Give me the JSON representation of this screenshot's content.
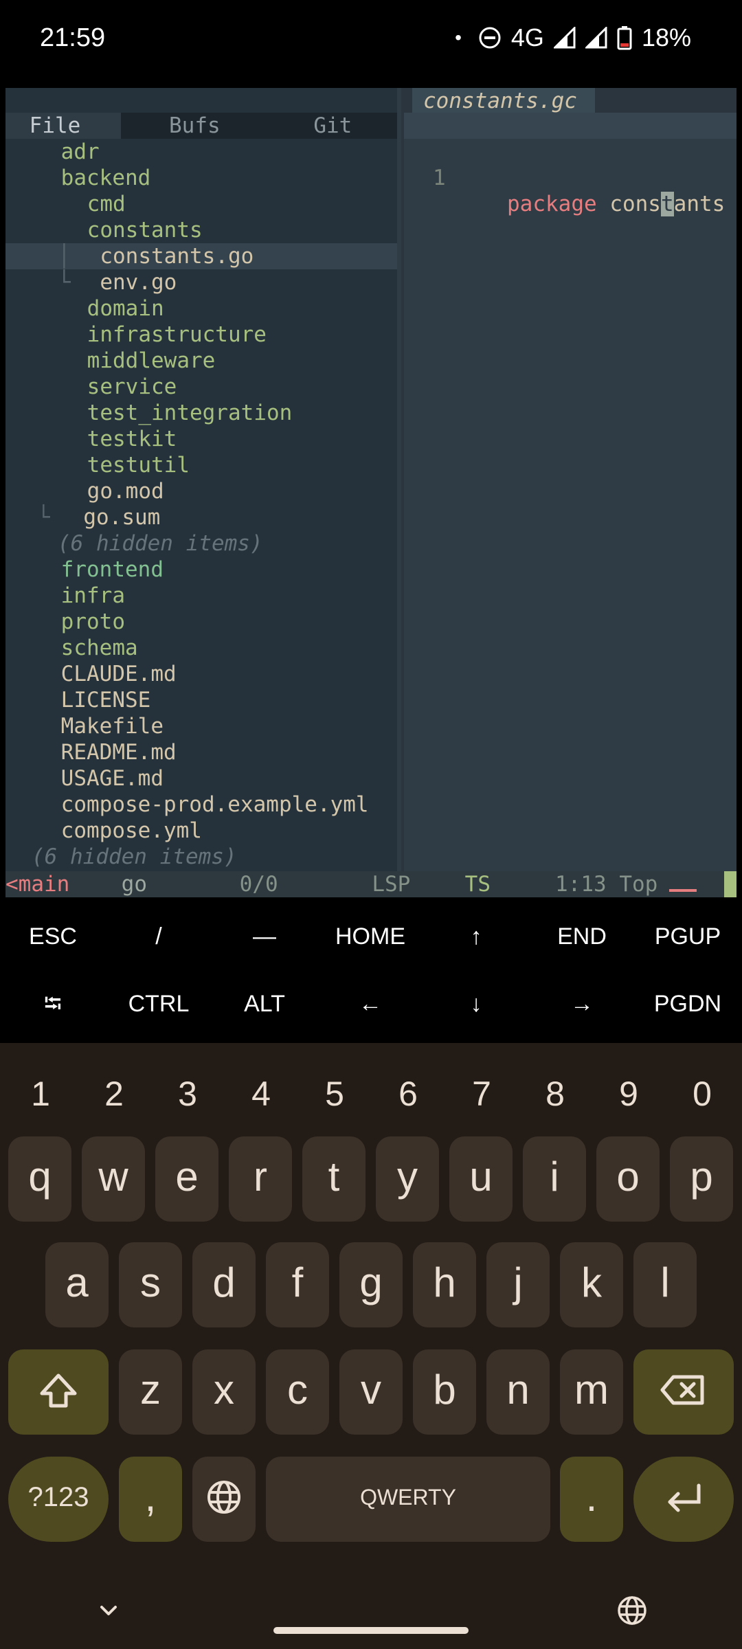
{
  "status_bar": {
    "time": "21:59",
    "dot": "•",
    "network": "4G",
    "battery": "18%",
    "icons": [
      "notification-dot-icon",
      "dnd-icon",
      "signal-icon",
      "signal-icon",
      "battery-low-icon"
    ]
  },
  "file_tree": {
    "tabs": [
      {
        "icon": "",
        "label": "File"
      },
      {
        "icon": "",
        "label": "Bufs"
      },
      {
        "icon": "",
        "label": "Git"
      }
    ],
    "rows": [
      {
        "guide": "",
        "icon": "",
        "name": "adr"
      },
      {
        "guide": "",
        "icon": "",
        "name": "backend"
      },
      {
        "guide": "",
        "icon": "",
        "name": "cmd"
      },
      {
        "guide": "",
        "icon": "",
        "name": "constants"
      },
      {
        "guide": "│",
        "icon": "",
        "name": "constants.go"
      },
      {
        "guide": "└",
        "icon": "",
        "name": "env.go"
      },
      {
        "guide": "",
        "icon": "",
        "name": "domain"
      },
      {
        "guide": "",
        "icon": "",
        "name": "infrastructure"
      },
      {
        "guide": "",
        "icon": "",
        "name": "middleware"
      },
      {
        "guide": "",
        "icon": "",
        "name": "service"
      },
      {
        "guide": "",
        "icon": "",
        "name": "test_integration"
      },
      {
        "guide": "",
        "icon": "",
        "name": "testkit"
      },
      {
        "guide": "",
        "icon": "",
        "name": "testutil"
      },
      {
        "guide": "",
        "icon": "",
        "name": "go.mod"
      },
      {
        "guide": "└",
        "icon": "",
        "name": "go.sum"
      },
      {
        "guide": "",
        "icon": "",
        "name": "(6 hidden items)"
      },
      {
        "guide": "",
        "icon": "",
        "name": "frontend",
        "git": ""
      },
      {
        "guide": "",
        "icon": "",
        "name": "infra"
      },
      {
        "guide": "",
        "icon": "",
        "name": "proto"
      },
      {
        "guide": "",
        "icon": "",
        "name": "schema"
      },
      {
        "guide": "",
        "icon": "",
        "name": "CLAUDE.md"
      },
      {
        "guide": "",
        "icon": "",
        "name": "LICENSE"
      },
      {
        "guide": "",
        "icon": "",
        "name": "Makefile"
      },
      {
        "guide": "",
        "icon": "",
        "name": "README.md"
      },
      {
        "guide": "",
        "icon": "",
        "name": "USAGE.md"
      },
      {
        "guide": "",
        "icon": "",
        "name": "compose-prod.example.yml"
      },
      {
        "guide": "",
        "icon": "",
        "name": "compose.yml"
      },
      {
        "guide": "",
        "icon": "",
        "name": "(6 hidden items)"
      }
    ]
  },
  "editor": {
    "tab_icon": "",
    "tab_name": "constants.gc",
    "tab_modified": "",
    "line_number": "1",
    "code_keyword": "package",
    "code_pre": " cons",
    "code_cursor": "t",
    "code_post": "ants"
  },
  "statusline": {
    "mode": "<main",
    "filetype": " go",
    "diagnostics": " 0/0",
    "lsp": "  LSP",
    "ts": " TS",
    "position": "1:13 Top"
  },
  "extra_keys": {
    "row1": [
      "ESC",
      "/",
      "—",
      "HOME",
      "↑",
      "END",
      "PGUP"
    ],
    "row2": [
      "⭾",
      "CTRL",
      "ALT",
      "←",
      "↓",
      "→",
      "PGDN"
    ]
  },
  "keyboard": {
    "numbers": [
      "1",
      "2",
      "3",
      "4",
      "5",
      "6",
      "7",
      "8",
      "9",
      "0"
    ],
    "row1": [
      "q",
      "w",
      "e",
      "r",
      "t",
      "y",
      "u",
      "i",
      "o",
      "p"
    ],
    "row2": [
      "a",
      "s",
      "d",
      "f",
      "g",
      "h",
      "j",
      "k",
      "l"
    ],
    "row3": [
      "z",
      "x",
      "c",
      "v",
      "b",
      "n",
      "m"
    ],
    "symbols_label": "?123",
    "comma": ",",
    "space_label": "QWERTY",
    "period": ".",
    "colors": {
      "key": "#3c3128",
      "func": "#4f4a1f",
      "background": "#221b16"
    }
  }
}
